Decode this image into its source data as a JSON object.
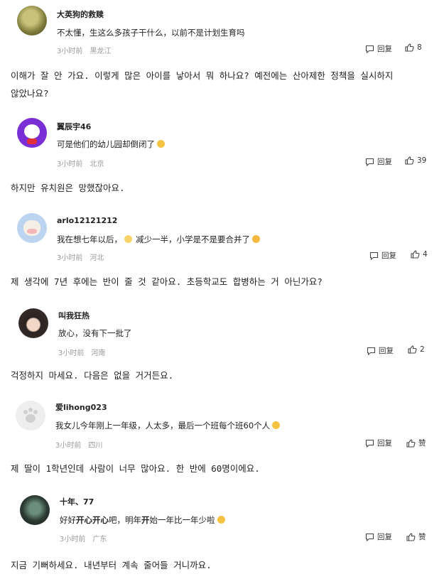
{
  "comments": [
    {
      "user": "大英狗的救赎",
      "text": "不太懂，生这么多孩子干什么，以前不是计划生育吗",
      "time": "3小时前",
      "location": "黑龙江",
      "reply_label": "回复",
      "likes": "8",
      "translation_l1": "이해가 잘 안 가요. 이렇게 많은 아이를 낳아서 뭐 하나요? 예전에는 산아제한 정책을 실시하지",
      "translation_l2": "않았나요?"
    },
    {
      "user": "翼辰宇46",
      "text": "可是他们的幼儿园却倒闭了",
      "time": "3小时前",
      "location": "北京",
      "reply_label": "回复",
      "likes": "39",
      "translation_l1": "하지만 유치원은 망했잖아요."
    },
    {
      "user": "arlo12121212",
      "text_a": "我在想七年以后，",
      "text_b": "减少一半，小学是不是要合并了",
      "time": "3小时前",
      "location": "河北",
      "reply_label": "回复",
      "likes": "4",
      "translation_l1": "제 생각에 7년 후에는 반이 줄 것 같아요. 초등학교도 합병하는 거 아닌가요?"
    },
    {
      "user": "叫我狂热",
      "text": "放心，没有下一批了",
      "time": "3小时前",
      "location": "河南",
      "reply_label": "回复",
      "likes": "2",
      "translation_l1": "걱정하지 마세요. 다음은 없을 거거든요."
    },
    {
      "user": "爱lihong023",
      "text": "我女儿今年刚上一年级，人太多，最后一个班每个班60个人",
      "time": "3小时前",
      "location": "四川",
      "reply_label": "回复",
      "likes": "赞",
      "translation_l1": "제 딸이 1학년인데 사람이 너무 많아요. 한 반에 60명이에요."
    },
    {
      "user": "十年、77",
      "text_p1": "好好",
      "text_p2": "开心",
      "text_p3": "开心",
      "text_p4": "吧，明年",
      "text_p5": "开",
      "text_p6": "始一年比一年少啦",
      "time": "3小时前",
      "location": "广东",
      "reply_label": "回复",
      "likes": "赞",
      "translation_l1": "지금 기뻐하세요. 내년부터 계속 줄어들 거니까요."
    }
  ],
  "colors": {
    "meta_gray": "#9a9a9a",
    "text": "#222222",
    "background": "#ffffff"
  }
}
